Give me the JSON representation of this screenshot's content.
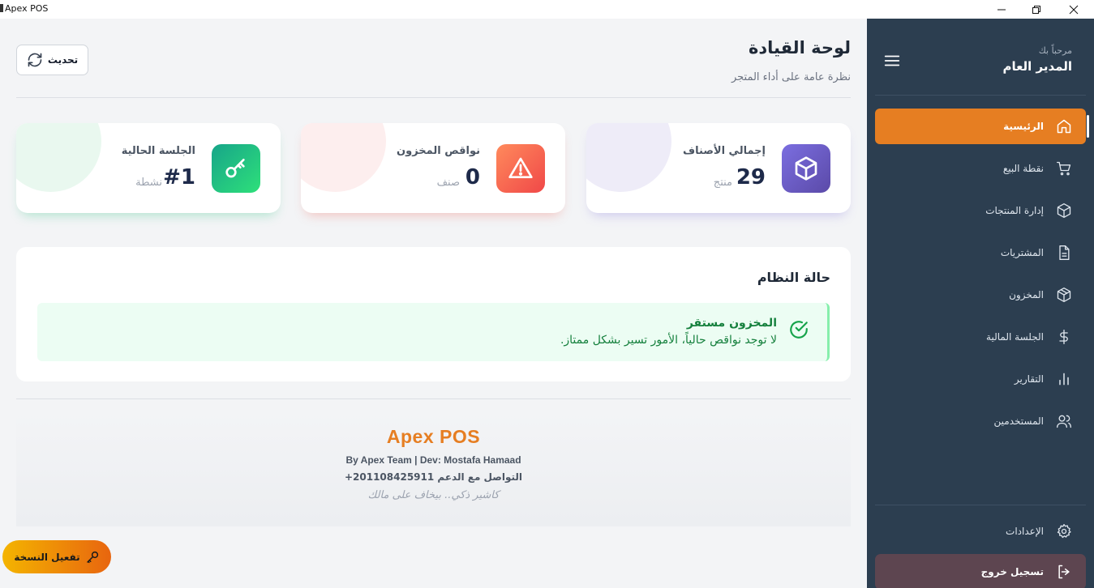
{
  "window": {
    "title": "Apex POS",
    "controls": [
      "minimize-icon",
      "maximize-icon",
      "close-icon"
    ]
  },
  "header": {
    "title": "لوحة القيادة",
    "subtitle": "نظرة عامة على أداء المتجر",
    "refresh_label": "تحديث"
  },
  "cards": [
    {
      "label": "إجمالي الأصناف",
      "value": "29",
      "unit": "منتج",
      "icon": "box-icon",
      "color": "#6d5cc8"
    },
    {
      "label": "نواقص المخزون",
      "value": "0",
      "unit": "صنف",
      "icon": "warning-icon",
      "color": "#f25c4c"
    },
    {
      "label": "الجلسة الحالية",
      "value": "#1",
      "unit": "نشطة",
      "icon": "key-icon",
      "color": "#22c07a"
    }
  ],
  "system_status": {
    "title": "حالة النظام",
    "alert_title": "المخزون مستقر",
    "alert_text": "لا توجد نواقص حالياً، الأمور تسير بشكل ممتاز."
  },
  "footer": {
    "brand": "Apex POS",
    "credits": "By Apex Team | Dev: Mostafa Hamaad",
    "support": "التواصل مع الدعم 201108425911+",
    "tagline": "كاشير ذكي.. بيخاف على مالك"
  },
  "activate_label": "تفعيل النسخة",
  "sidebar": {
    "welcome": "مرحباً بك",
    "user": "المدير العام",
    "items": [
      {
        "label": "الرئيسية",
        "icon": "home-icon",
        "active": true
      },
      {
        "label": "نقطة البيع",
        "icon": "cart-icon"
      },
      {
        "label": "إدارة المنتجات",
        "icon": "box-icon"
      },
      {
        "label": "المشتريات",
        "icon": "document-icon"
      },
      {
        "label": "المخزون",
        "icon": "package-icon"
      },
      {
        "label": "الجلسة المالية",
        "icon": "dollar-icon"
      },
      {
        "label": "التقارير",
        "icon": "bar-chart-icon"
      },
      {
        "label": "المستخدمين",
        "icon": "users-icon"
      }
    ],
    "settings": {
      "label": "الإعدادات",
      "icon": "gear-icon"
    },
    "logout": {
      "label": "تسجيل خروج",
      "icon": "logout-icon"
    }
  },
  "colors": {
    "accent": "#e67e22",
    "sidebar_bg": "#2c3e50",
    "success": "#15803d"
  }
}
